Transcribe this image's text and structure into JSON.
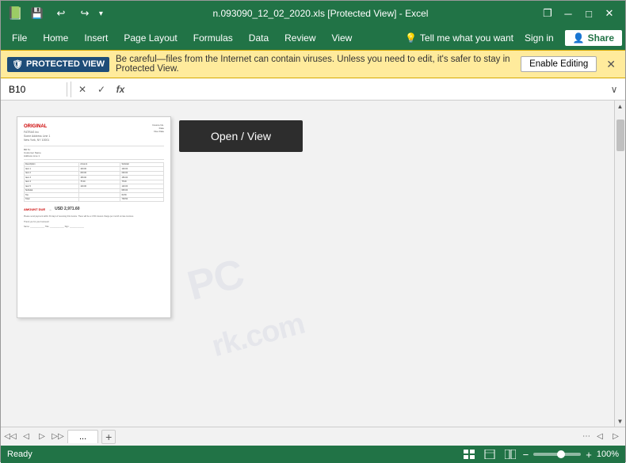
{
  "titlebar": {
    "title": "n.093090_12_02_2020.xls [Protected View] - Excel",
    "save_icon": "💾",
    "undo_icon": "↩",
    "redo_icon": "↪",
    "min_btn": "─",
    "max_btn": "□",
    "close_btn": "✕",
    "restore_btn": "❐"
  },
  "menubar": {
    "items": [
      "File",
      "Home",
      "Insert",
      "Page Layout",
      "Formulas",
      "Data",
      "Review",
      "View"
    ],
    "tell_me": "Tell me what you want",
    "tell_me_icon": "💡",
    "sign_in": "Sign in",
    "share": "Share",
    "share_icon": "👤"
  },
  "protected_view": {
    "label": "PROTECTED VIEW",
    "shield": "🛡",
    "message": "Be careful—files from the Internet can contain viruses. Unless you need to edit, it's safer to stay in Protected View.",
    "enable_btn": "Enable Editing",
    "close_btn": "✕"
  },
  "formula_bar": {
    "cell_ref": "B10",
    "cancel_btn": "✕",
    "confirm_btn": "✓",
    "fx": "fx",
    "formula_value": "",
    "expand_btn": "∨"
  },
  "sheet": {
    "open_view_btn": "Open / View",
    "watermark": "PC\nrk.com"
  },
  "tabs": {
    "prev_btn": "◁",
    "next_btn": "▷",
    "sheet_name": "...",
    "add_btn": "+",
    "scroll_left": "◁",
    "scroll_right": "▷"
  },
  "statusbar": {
    "ready": "Ready",
    "zoom_minus": "−",
    "zoom_plus": "+",
    "zoom_level": "100%"
  }
}
